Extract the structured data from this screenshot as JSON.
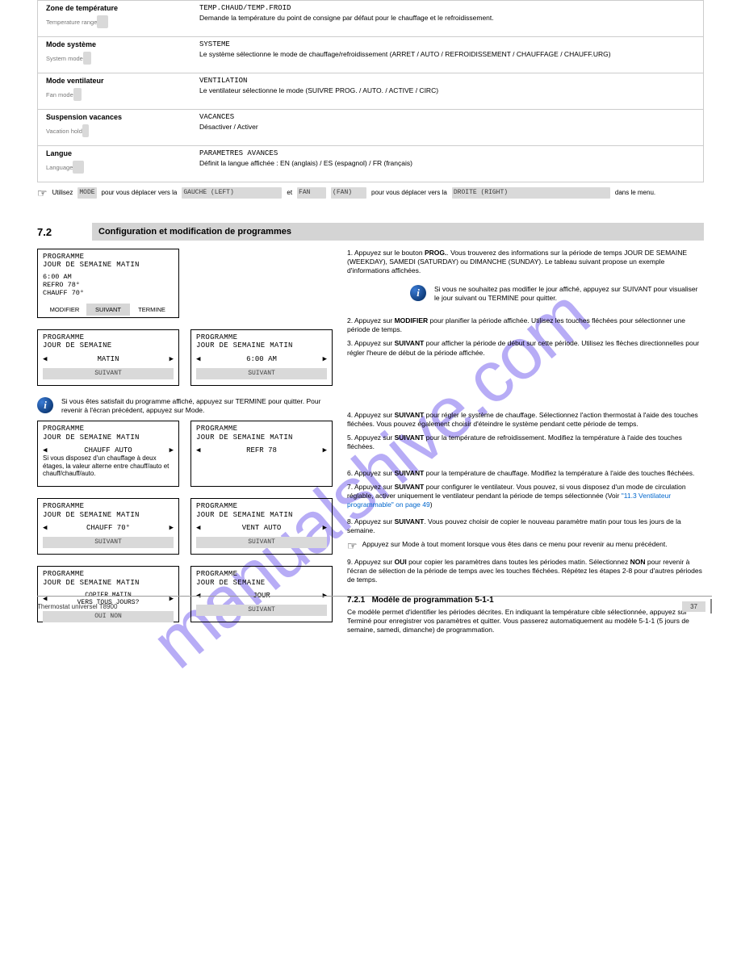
{
  "watermark": "manualshive.com",
  "rows": [
    {
      "title": "Zone de température",
      "dim": "Temperature range",
      "pill_w": "14",
      "code": "TEMP.CHAUD/TEMP.FROID",
      "sub": "Demande la température du point de consigne par défaut pour le chauffage et le refroidissement."
    },
    {
      "title": "Mode système",
      "dim": "System mode",
      "pill_w": "10",
      "code": "SYSTEME",
      "sub": "Le système sélectionne le mode de chauffage/refroidissement (ARRET / AUTO / REFROIDISSEMENT / CHAUFFAGE / CHAUFF.URG)"
    },
    {
      "title": "Mode ventilateur",
      "dim": "Fan mode",
      "pill_w": "10",
      "code": "VENTILATION",
      "sub": "Le ventilateur sélectionne le mode (SUIVRE PROG. / AUTO. / ACTIVE / CIRC)"
    },
    {
      "title": "Suspension vacances",
      "dim": "Vacation hold",
      "pill_w": "8",
      "code": "VACANCES",
      "sub": "Désactiver / Activer"
    },
    {
      "title": "Langue",
      "dim": "Language",
      "pill_w": "14",
      "code": "PARAMETRES AVANCES",
      "sub": "Définit la langue affichée : EN (anglais) / ES (espagnol) / FR (français)"
    }
  ],
  "note_line": {
    "pre": "Utilisez",
    "chip1": "MODE",
    "w1": "50",
    "mid1": " pour vous déplacer vers la ",
    "chip2": "GAUCHE (LEFT)",
    "w2": "124",
    "mid2": "et",
    "chip3": "FAN",
    "w3": "36",
    "chip4": "(FAN)",
    "w4": "44",
    "mid3": "pour vous déplacer vers la",
    "chip5": "DROITE (RIGHT)",
    "w5": "196",
    "post": "dans le menu."
  },
  "section": {
    "num": "7.2",
    "title": "Configuration et modification de programmes"
  },
  "intro": {
    "num": "1.",
    "b": "Appuyez sur le bouton",
    "btn": "PROG.",
    "rest": "Vous trouverez des informations sur la période de temps JOUR DE SEMAINE (WEEKDAY), SAMEDI (SATURDAY) ou DIMANCHE (SUNDAY). Le tableau suivant propose un exemple d'informations affichées."
  },
  "card_intro": {
    "line1": "PROGRAMME",
    "line2": "JOUR DE SEMAINE MATIN",
    "t1": "6:00 AM",
    "t2": "REFRO 78°",
    "t3": "CHAUFF 70°",
    "tab": [
      "MODIFIER",
      "SUIVANT",
      "TERMINE"
    ]
  },
  "info_right": "Si vous ne souhaitez pas modifier le jour affiché, appuyez sur SUIVANT pour visualiser le jour suivant ou TERMINE pour quitter.",
  "row2": {
    "c1": {
      "l1": "PROGRAMME",
      "l2": "JOUR DE SEMAINE",
      "val": "MATIN",
      "foot": "SUIVANT"
    },
    "c2": {
      "l1": "PROGRAMME",
      "l2": "JOUR DE SEMAINE MATIN",
      "val": "6:00 AM",
      "foot": "SUIVANT"
    }
  },
  "para2": {
    "pre": "2. Appuyez sur ",
    "b": "MODIFIER",
    "rest": " pour planifier la période affichée. Utilisez les touches fléchées pour sélectionner une période de temps."
  },
  "para2b": {
    "pre": "3. Appuyez sur ",
    "b": "SUIVANT",
    "rest": " pour afficher la période de début sur cette période. Utilisez les flèches directionnelles pour régler l'heure de début de la période affichée."
  },
  "info_left": "Si vous êtes satisfait du programme affiché, appuyez sur TERMINE pour quitter. Pour revenir à l'écran précédent, appuyez sur Mode.",
  "row3": {
    "c1": {
      "l1": "PROGRAMME",
      "l2": "JOUR DE SEMAINE MATIN",
      "val": "CHAUFF AUTO",
      "note": "Si vous disposez d'un chauffage à deux étages, la valeur alterne entre chauff/auto et chauff/chauff/auto.",
      "foot": ""
    },
    "c2": {
      "l1": "PROGRAMME",
      "l2": "JOUR DE SEMAINE MATIN",
      "val": "REFR 78",
      "foot": ""
    }
  },
  "para3": {
    "pre": "4. Appuyez sur ",
    "b": "SUIVANT",
    "rest": " pour régler le système de chauffage. Sélectionnez l'action thermostat à l'aide des touches fléchées. Vous pouvez également choisir d'éteindre le système pendant cette période de temps."
  },
  "para3b": {
    "pre": "5. Appuyez sur ",
    "b": "SUIVANT",
    "rest": " pour la température de refroidissement. Modifiez la température à l'aide des touches fléchées."
  },
  "row4": {
    "c1": {
      "l1": "PROGRAMME",
      "l2": "JOUR DE SEMAINE MATIN",
      "val": "CHAUFF 70°",
      "foot": "SUIVANT"
    },
    "c2": {
      "l1": "PROGRAMME",
      "l2": "JOUR DE SEMAINE MATIN",
      "val": "VENT AUTO",
      "foot": "SUIVANT"
    }
  },
  "para4": {
    "pre": "6. Appuyez sur ",
    "b": "SUIVANT",
    "rest": " pour la température de chauffage. Modifiez la température à l'aide des touches fléchées."
  },
  "para4b": {
    "pre": "7. Appuyez sur ",
    "b": "SUIVANT",
    "rest": " pour configurer le ventilateur. Vous pouvez, si vous disposez d'un mode de circulation réglable, activer uniquement le ventilateur pendant la période de temps sélectionnée (Voir ",
    "link": "\"11.3 Ventilateur programmable\" on page 49",
    "post": ")"
  },
  "row5": {
    "c1": {
      "l1": "PROGRAMME",
      "l2": "JOUR DE SEMAINE MATIN",
      "note": "COPIER MATIN\nVERS TOUS JOURS?",
      "foot": "OUI        NON"
    },
    "c2": {
      "l1": "PROGRAMME",
      "l2": "JOUR DE SEMAINE",
      "val": "JOUR",
      "foot": "SUIVANT"
    }
  },
  "para5": {
    "pre": "8. Appuyez sur ",
    "b": "SUIVANT",
    "rest": ". Vous pouvez choisir de copier le nouveau paramètre matin pour tous les jours de la semaine."
  },
  "hand_note": "Appuyez sur Mode à tout moment lorsque vous êtes dans ce menu pour revenir au menu précédent.",
  "para5b": {
    "pre": "9. Appuyez sur ",
    "b": "OUI",
    "rest": " pour copier les paramètres dans toutes les périodes matin. Sélectionnez ",
    "b2": "NON",
    "rest2": " pour revenir à l'écran de sélection de la période de temps avec les touches fléchées. Répétez les étapes 2-8 pour d'autres périodes de temps."
  },
  "section2": {
    "num": "7.2.1",
    "title": "Modèle de programmation 5-1-1"
  },
  "section2_desc": "Ce modèle permet d'identifier les périodes décrites. En indiquant la température cible sélectionnée, appuyez sur Terminé pour enregistrer vos paramètres et quitter. Vous passerez automatiquement au modèle 5-1-1 (5 jours de semaine, samedi, dimanche) de programmation.",
  "footer": {
    "left": "Thermostat universel T8900",
    "page": "37",
    "right": ""
  }
}
